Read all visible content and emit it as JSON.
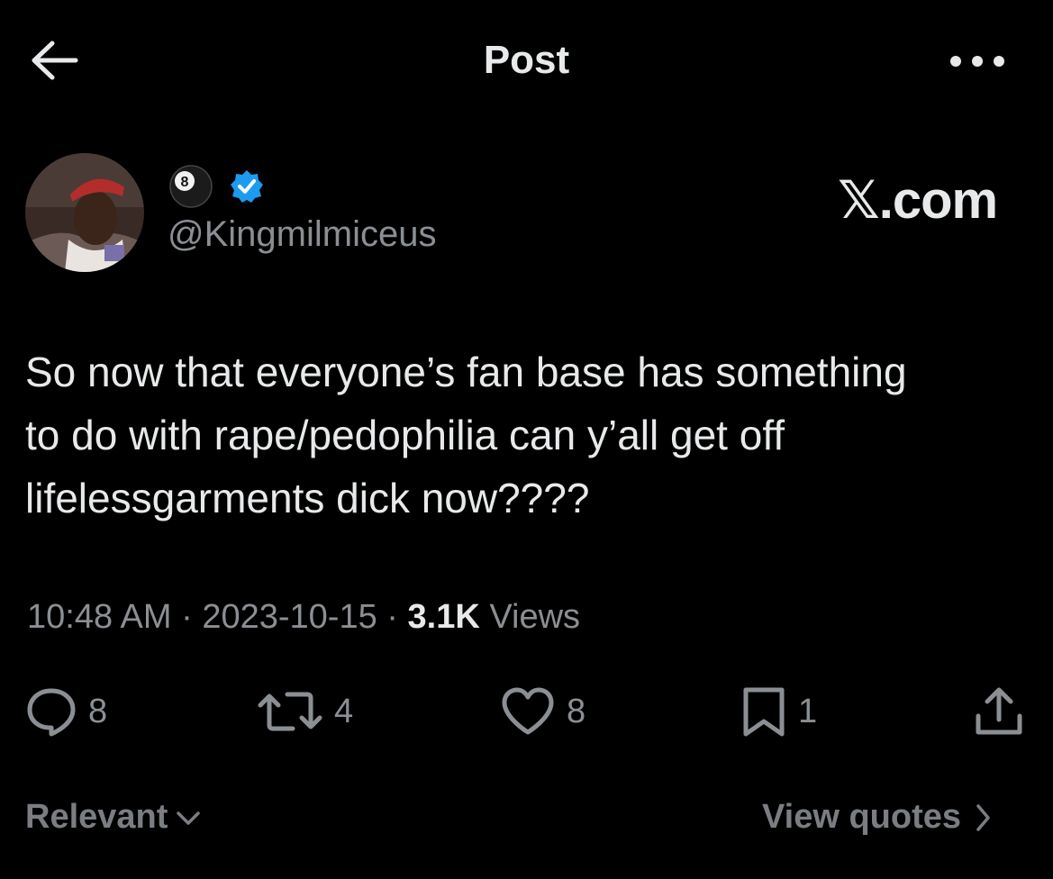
{
  "header": {
    "title": "Post"
  },
  "author": {
    "handle": "@Kingmilmiceus",
    "name_emoji": "8",
    "verified": true
  },
  "watermark": "𝕏.com",
  "post": {
    "text": "So now that everyone’s fan base has something\nto do with rape/pedophilia can y’all get off\nlifelessgarments dick now????"
  },
  "meta": {
    "time": "10:48 AM",
    "separator": " · ",
    "date": "2023-10-15",
    "views_count": "3.1K",
    "views_label": " Views"
  },
  "actions": {
    "replies": "8",
    "reposts": "4",
    "likes": "8",
    "bookmarks": "1"
  },
  "footer": {
    "sort_label": "Relevant",
    "quotes_label": "View quotes"
  },
  "colors": {
    "background": "#000000",
    "text": "#e7e9ea",
    "muted": "#8b8f94",
    "verified": "#1d9bf0"
  }
}
